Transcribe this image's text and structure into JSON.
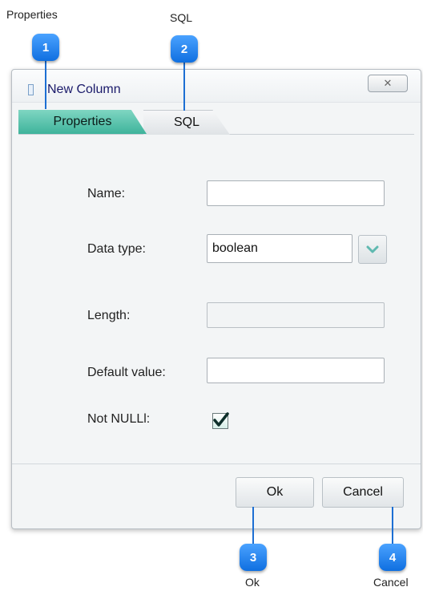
{
  "callouts": {
    "properties": {
      "label": "Properties",
      "number": "1"
    },
    "sql": {
      "label": "SQL",
      "number": "2"
    },
    "ok": {
      "label": "Ok",
      "number": "3"
    },
    "cancel": {
      "label": "Cancel",
      "number": "4"
    }
  },
  "window": {
    "title": "New Column",
    "close_symbol": "✕"
  },
  "tabs": [
    {
      "label": "Properties",
      "active": true
    },
    {
      "label": "SQL",
      "active": false
    }
  ],
  "form": {
    "name": {
      "label": "Name:",
      "value": ""
    },
    "data_type": {
      "label": "Data type:",
      "value": "boolean"
    },
    "length": {
      "label": "Length:",
      "value": "",
      "enabled": false
    },
    "default_value": {
      "label": "Default value:",
      "value": ""
    },
    "not_null": {
      "label": "Not NULLl:",
      "checked": true
    }
  },
  "buttons": {
    "ok": "Ok",
    "cancel": "Cancel"
  },
  "icons": {
    "dropdown": "chevron-down-icon",
    "checkmark": "checkmark-icon",
    "close": "close-icon"
  },
  "colors": {
    "accent_teal": "#3eb39b",
    "callout_blue": "#0f6fe0",
    "title_text": "#1a1a6a"
  }
}
